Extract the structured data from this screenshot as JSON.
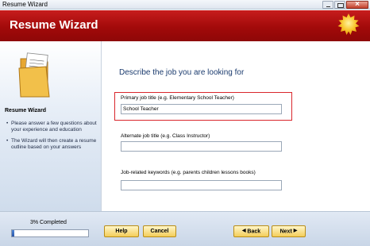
{
  "window": {
    "title": "Resume Wizard"
  },
  "header": {
    "title": "Resume Wizard",
    "logo_icon": "sun-icon"
  },
  "sidebar": {
    "title": "Resume Wizard",
    "icon": "folder-icon",
    "tips": [
      "Please answer a few questions about your experience and education",
      "The Wizard will then create a resume outline based on your answers"
    ]
  },
  "main": {
    "heading": "Describe the job you are looking for",
    "fields": [
      {
        "label": "Primary job title (e.g. Elementary School Teacher)",
        "value": "School Teacher",
        "highlighted": true
      },
      {
        "label": "Alternate job title (e.g. Class Instructor)",
        "value": ""
      },
      {
        "label": "Job-related keywords (e.g. parents children lessons books)",
        "value": ""
      }
    ]
  },
  "footer": {
    "progress_label": "3% Completed",
    "progress_fraction": 0.03,
    "buttons": {
      "help": "Help",
      "cancel": "Cancel",
      "back": "Back",
      "next": "Next"
    }
  },
  "colors": {
    "header": "#a20a0a",
    "highlight_border": "#d9262c",
    "button": "#f4cd59",
    "heading_text": "#1b3b6e"
  }
}
